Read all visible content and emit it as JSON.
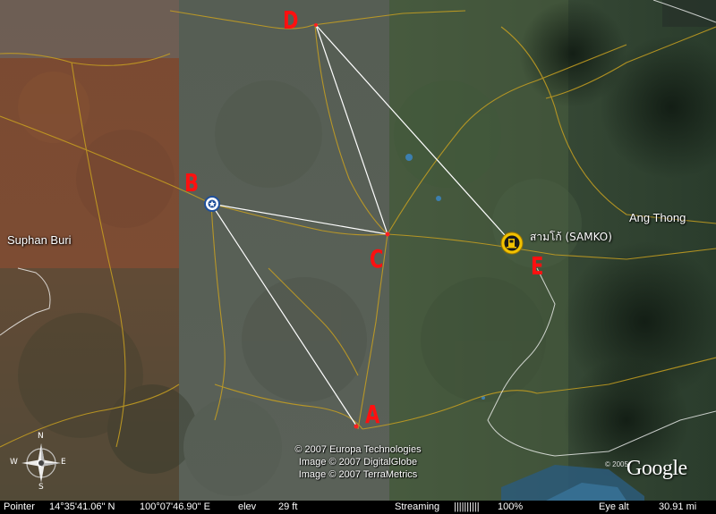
{
  "map": {
    "places": [
      {
        "id": "suphan-buri",
        "label": "Suphan Buri"
      },
      {
        "id": "ang-thong",
        "label": "Ang Thong"
      }
    ],
    "poi": {
      "label": "สามโก้ (SAMKO)",
      "icon": "gas-station-placemark-icon"
    },
    "origin_marker_icon": "star-target-icon",
    "annotations": [
      "A",
      "B",
      "C",
      "D",
      "E"
    ],
    "colors": {
      "annotation": "#ff1010",
      "path_lines": "#ffffff",
      "roads": "#c8a020",
      "boundary": "#ffffff",
      "poi_ring": "#f2c200"
    }
  },
  "compass": {
    "north": "N",
    "south": "S",
    "east": "E",
    "west": "W"
  },
  "credits": [
    "© 2007 Europa Technologies",
    "Image © 2007 DigitalGlobe",
    "Image © 2007 TerraMetrics"
  ],
  "logo": {
    "small": "© 2005",
    "text": "Google"
  },
  "status": {
    "pointer_label": "Pointer",
    "latitude": "14°35'41.06\" N",
    "longitude": "100°07'46.90\" E",
    "elev_label": "elev",
    "elev_value": "29 ft",
    "streaming_label": "Streaming",
    "streaming_bars": "||||||||||",
    "streaming_percent": "100%",
    "eye_alt_label": "Eye  alt",
    "eye_alt_value": "30.91 mi"
  }
}
